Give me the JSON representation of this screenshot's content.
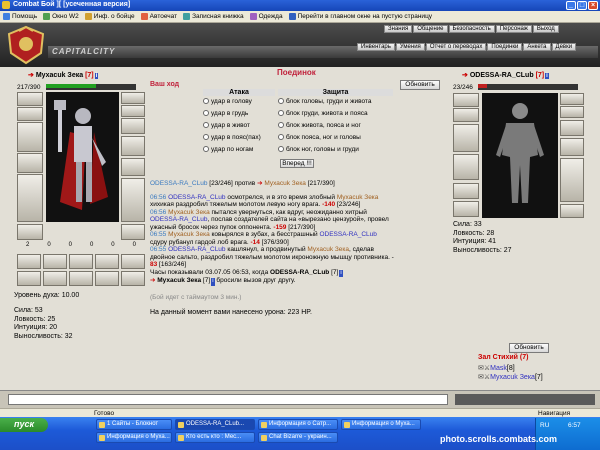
{
  "window": {
    "title": "Combat Бой ][ [усеченная версия]"
  },
  "toolbar": {
    "items": [
      "Помощь",
      "Окно W2",
      "Инф. о бойце",
      "Автоечат",
      "Записная книжка",
      "Одежда",
      "Перейти в главном окне на пустую страницу"
    ]
  },
  "header": {
    "brand": "CAPITALCITY",
    "top_menu": [
      "Знания",
      "Общение",
      "Безопасность",
      "Персонаж",
      "Выход"
    ],
    "game_menu": [
      "Инвентарь",
      "Умения",
      "Отчет о переводах",
      "Поединки",
      "Анкета",
      "Девки"
    ]
  },
  "left_fighter": {
    "name": "Мухасuk Зека",
    "level": "[7]",
    "hp": "217/390",
    "hp_fraction": 0.56,
    "bottom_counts": [
      "2",
      "0",
      "0",
      "0",
      "0",
      "0"
    ],
    "spirit_level": "Уровень духа: 10.00",
    "stats": [
      "Сила: 53",
      "Ловкость: 25",
      "Интуиция: 20",
      "Выносливость: 32"
    ]
  },
  "right_fighter": {
    "name": "ODESSA-RA_CLub",
    "level": "[7]",
    "hp": "23/246",
    "hp_fraction": 0.09,
    "stats": [
      "Сила: 33",
      "Ловкость: 28",
      "Интуиция: 41",
      "Выносливость: 27"
    ]
  },
  "fight": {
    "your_move": "Ваш ход",
    "title": "Поединок",
    "refresh": "Обновить",
    "attack_header": "Атака",
    "defense_header": "Защита",
    "attacks": [
      "удар в голову",
      "удар в грудь",
      "удар в живот",
      "удар в пояс(пах)",
      "удар по ногам"
    ],
    "defenses": [
      "блок головы, груди и живота",
      "блок груди, живота и пояса",
      "блок живота, пояса и ног",
      "блок пояса, ног и головы",
      "блок ног, головы и груди"
    ],
    "submit": "Вперед !!!"
  },
  "log": {
    "versus": {
      "left": "ODESSA-RA_CLub",
      "left_hp": "[23/246]",
      "word": "против",
      "right": "Мухасuk Зека",
      "right_hp": "[217/390]"
    },
    "entries": [
      {
        "time": "06:56",
        "a": "ODESSA-RA_CLub",
        "t1": " осмотрелся, и в это время злобный ",
        "b": "Мухасuk Зека",
        "t2": " хихикая раздробил тяжелым молотом левую ногу врага. ",
        "dmg": "-140",
        "hp": " [23/246]"
      },
      {
        "time": "06:56",
        "a": "Мухасuk Зека",
        "t1": " пытался увернуться, как вдруг, неожиданно хитрый ",
        "b": "ODESSA-RA_CLub",
        "t2": ", послав создателей сайта на «вырезано цензурой», провел ужасный бросок через пупок оппонента. ",
        "dmg": "-159",
        "hp": " [217/390]"
      },
      {
        "time": "06:55",
        "a": "Мухасuk Зека",
        "t1": " ковырялся в зубах, а бесстрашный ",
        "b": "ODESSA-RA_CLub",
        "t2": " сдуру рубанул гардой лоб врага. ",
        "dmg": "-14",
        "hp": " [376/390]"
      },
      {
        "time": "06:55",
        "a": "ODESSA-RA_CLub",
        "t1": " кашлянул, а продвинутый ",
        "b": "Мухасuk Зека",
        "t2": ", сделав двойное сальто, раздробил тяжелым молотом икроножную мышцу противника. - ",
        "dmg": "83",
        "hp": " [163/246]"
      }
    ],
    "clock_line": "Часы показывали 03.07.05 06:53, когда",
    "clock_name": "ODESSA-RA_CLub",
    "clock_level": "[7]",
    "challenge_name": "Мухасuk Зека",
    "challenge_level": "[7]",
    "challenge_text": "бросили вызов друг другу.",
    "timeout_note": "(Бой идет с таймаутом 3 мин.)",
    "damage_line": "На данный момент вами нанесено урона: 223 HP."
  },
  "right_panel": {
    "refresh": "Обновить",
    "room": "Зал Стихий (7)",
    "members": [
      {
        "name": "Mask",
        "level": "[8]"
      },
      {
        "name": "Мухасuk Зека",
        "level": "[7]"
      }
    ]
  },
  "statusbar": {
    "left": "Готово",
    "right": "Навигация"
  },
  "taskbar": {
    "start": "пуск",
    "tasks": [
      "1 Сайты - Блокнот",
      "ODESSA-RA_CLub...",
      "Информация о Сатр...",
      "Информация о Муха...",
      "Информация о Муха...",
      "Кто есть кто : Мес...",
      "Chat Bizarre - украин..."
    ],
    "lang": "RU",
    "clock": "6:57",
    "watermark": "photo.scrolls.combats.com"
  }
}
